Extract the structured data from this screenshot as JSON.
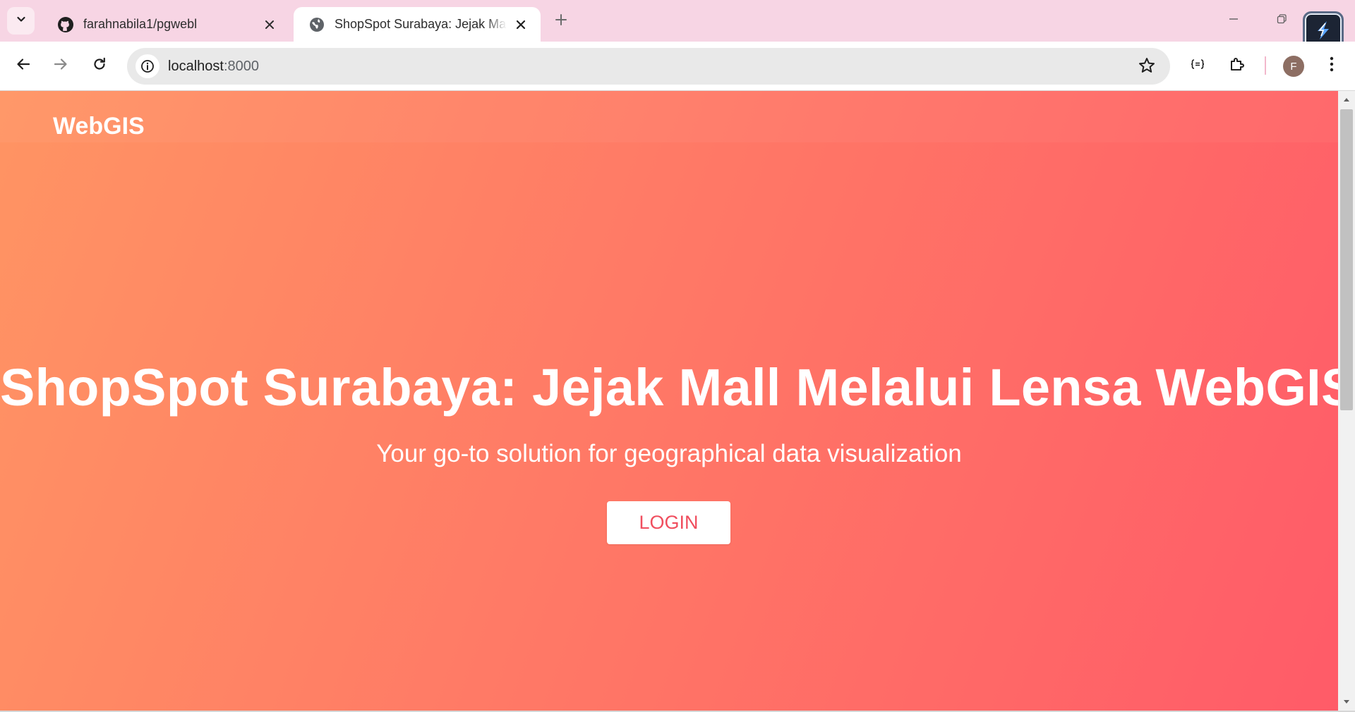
{
  "browser": {
    "tabs": [
      {
        "title": "farahnabila1/pgwebl",
        "favicon": "github-icon",
        "active": false
      },
      {
        "title": "ShopSpot Surabaya: Jejak Mall Melalui Lensa WebGIS",
        "favicon": "globe-icon",
        "active": true
      }
    ],
    "address": {
      "host": "localhost",
      "port": ":8000"
    },
    "profile_initial": "F"
  },
  "page": {
    "brand": "WebGIS",
    "hero": {
      "title": "ShopSpot Surabaya: Jejak Mall Melalui Lensa WebGIS",
      "subtitle": "Your go-to solution for geographical data visualization",
      "login_label": "LOGIN"
    }
  },
  "colors": {
    "tabstrip": "#f7d5e4",
    "gradient_start": "#ff9463",
    "gradient_end": "#ff5b68",
    "login_text": "#f04e5e"
  }
}
